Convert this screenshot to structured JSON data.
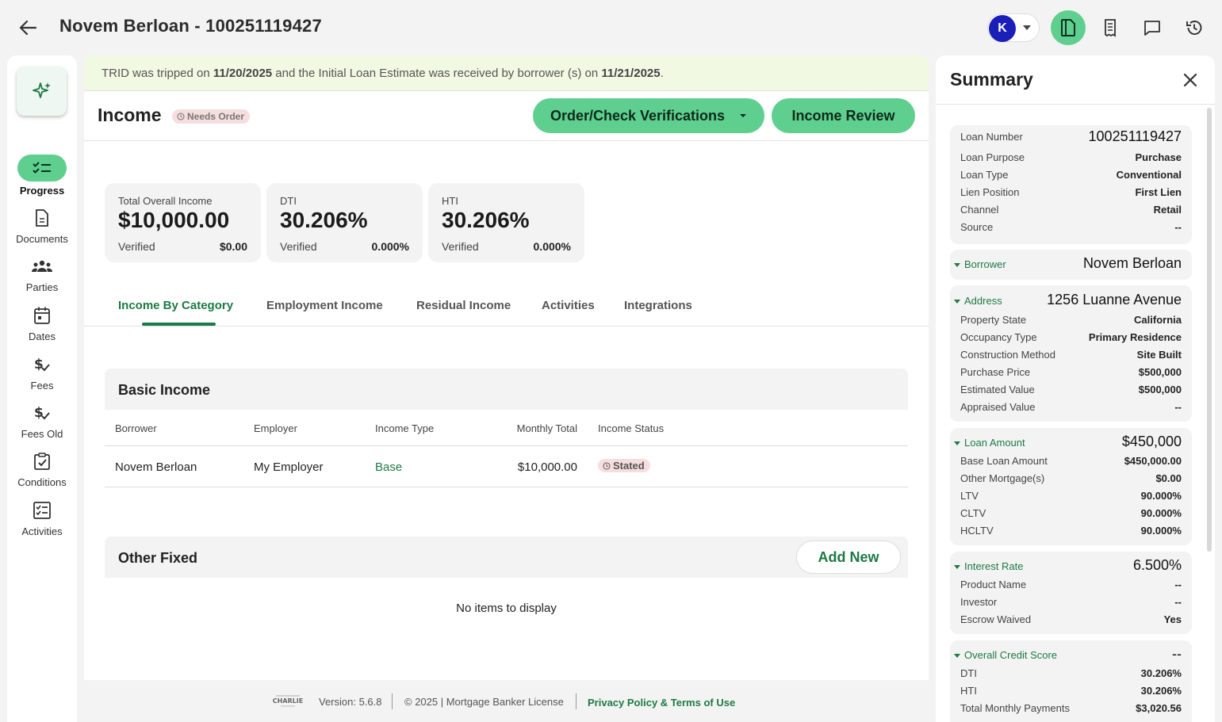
{
  "header": {
    "title": "Novem Berloan - 100251119427",
    "user_initial": "K"
  },
  "leftnav": {
    "items": [
      {
        "label": "Progress"
      },
      {
        "label": "Documents"
      },
      {
        "label": "Parties"
      },
      {
        "label": "Dates"
      },
      {
        "label": "Fees"
      },
      {
        "label": "Fees Old"
      },
      {
        "label": "Conditions"
      },
      {
        "label": "Activities"
      }
    ]
  },
  "trid": {
    "prefix": "TRID was tripped on ",
    "tripped_date": "11/20/2025",
    "middle": " and the Initial Loan Estimate was received by borrower (s) on ",
    "received_date": "11/21/2025",
    "suffix": "."
  },
  "income": {
    "title": "Income",
    "status_badge": "Needs Order",
    "order_button": "Order/Check Verifications",
    "review_button": "Income Review"
  },
  "stats": [
    {
      "label": "Total Overall Income",
      "value": "$10,000.00",
      "verified_label": "Verified",
      "verified_value": "$0.00"
    },
    {
      "label": "DTI",
      "value": "30.206%",
      "verified_label": "Verified",
      "verified_value": "0.000%"
    },
    {
      "label": "HTI",
      "value": "30.206%",
      "verified_label": "Verified",
      "verified_value": "0.000%"
    }
  ],
  "tabs": [
    {
      "label": "Income By Category"
    },
    {
      "label": "Employment Income"
    },
    {
      "label": "Residual Income"
    },
    {
      "label": "Activities"
    },
    {
      "label": "Integrations"
    }
  ],
  "basic_income": {
    "title": "Basic Income",
    "columns": [
      "Borrower",
      "Employer",
      "Income Type",
      "Monthly Total",
      "Income Status"
    ],
    "rows": [
      {
        "borrower": "Novem Berloan",
        "employer": "My Employer",
        "income_type": "Base",
        "monthly_total": "$10,000.00",
        "status": "Stated"
      }
    ]
  },
  "other_fixed": {
    "title": "Other Fixed",
    "add_button": "Add New",
    "empty_message": "No items to display"
  },
  "footer": {
    "logo_text": "CHARLIE",
    "version": "Version: 5.6.8",
    "copyright": "© 2025 | Mortgage Banker License",
    "privacy": "Privacy Policy & Terms of Use"
  },
  "summary": {
    "title": "Summary",
    "loan": [
      {
        "k": "Loan Number",
        "v": "100251119427"
      },
      {
        "k": "Loan Purpose",
        "v": "Purchase"
      },
      {
        "k": "Loan Type",
        "v": "Conventional"
      },
      {
        "k": "Lien Position",
        "v": "First Lien"
      },
      {
        "k": "Channel",
        "v": "Retail"
      },
      {
        "k": "Source",
        "v": "--"
      }
    ],
    "borrower": {
      "k": "Borrower",
      "v": "Novem Berloan"
    },
    "address": {
      "k": "Address",
      "v": "1256 Luanne Avenue",
      "rows": [
        {
          "k": "Property State",
          "v": "California"
        },
        {
          "k": "Occupancy Type",
          "v": "Primary Residence"
        },
        {
          "k": "Construction Method",
          "v": "Site Built"
        },
        {
          "k": "Purchase Price",
          "v": "$500,000"
        },
        {
          "k": "Estimated Value",
          "v": "$500,000"
        },
        {
          "k": "Appraised Value",
          "v": "--"
        }
      ]
    },
    "loan_amount": {
      "k": "Loan Amount",
      "v": "$450,000",
      "rows": [
        {
          "k": "Base Loan Amount",
          "v": "$450,000.00"
        },
        {
          "k": "Other Mortgage(s)",
          "v": "$0.00"
        },
        {
          "k": "LTV",
          "v": "90.000%"
        },
        {
          "k": "CLTV",
          "v": "90.000%"
        },
        {
          "k": "HCLTV",
          "v": "90.000%"
        }
      ]
    },
    "interest_rate": {
      "k": "Interest Rate",
      "v": "6.500%",
      "rows": [
        {
          "k": "Product Name",
          "v": "--"
        },
        {
          "k": "Investor",
          "v": "--"
        },
        {
          "k": "Escrow Waived",
          "v": "Yes"
        }
      ]
    },
    "credit": {
      "k": "Overall Credit Score",
      "v": "--",
      "rows": [
        {
          "k": "DTI",
          "v": "30.206%"
        },
        {
          "k": "HTI",
          "v": "30.206%"
        },
        {
          "k": "Total Monthly Payments",
          "v": "$3,020.56"
        }
      ]
    }
  }
}
